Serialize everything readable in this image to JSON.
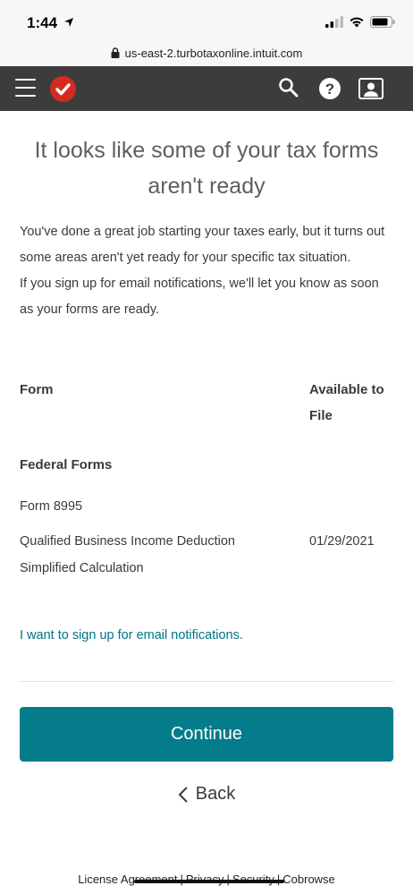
{
  "status_bar": {
    "time": "1:44"
  },
  "browser": {
    "url": "us-east-2.turbotaxonline.intuit.com"
  },
  "header": {
    "icons": [
      "menu-icon",
      "turbotax-check-logo",
      "search-icon",
      "help-icon",
      "profile-card-icon"
    ]
  },
  "main": {
    "title": "It looks like some of your tax forms aren't ready",
    "intro_p1": "You've done a great job starting your taxes early, but it turns out some areas aren't yet ready for your specific tax situation.",
    "intro_p2": "If you sign up for email notifications, we'll let you know as soon as your forms are ready.",
    "table": {
      "col_form": "Form",
      "col_available": "Available to File",
      "section": "Federal Forms",
      "rows": [
        {
          "form_number": "Form 8995",
          "form_name": "Qualified Business Income Deduction Simplified Calculation",
          "date": "01/29/2021"
        }
      ]
    },
    "email_link": "I want to sign up for email notifications.",
    "continue_label": "Continue",
    "back_label": "Back"
  },
  "footer": {
    "links": [
      "License Agreement",
      "Privacy",
      "Security",
      "Cobrowse"
    ]
  },
  "colors": {
    "header_bg": "#3c3c3c",
    "accent": "#057c8b",
    "link": "#00738a",
    "logo_red": "#d52b1e"
  }
}
